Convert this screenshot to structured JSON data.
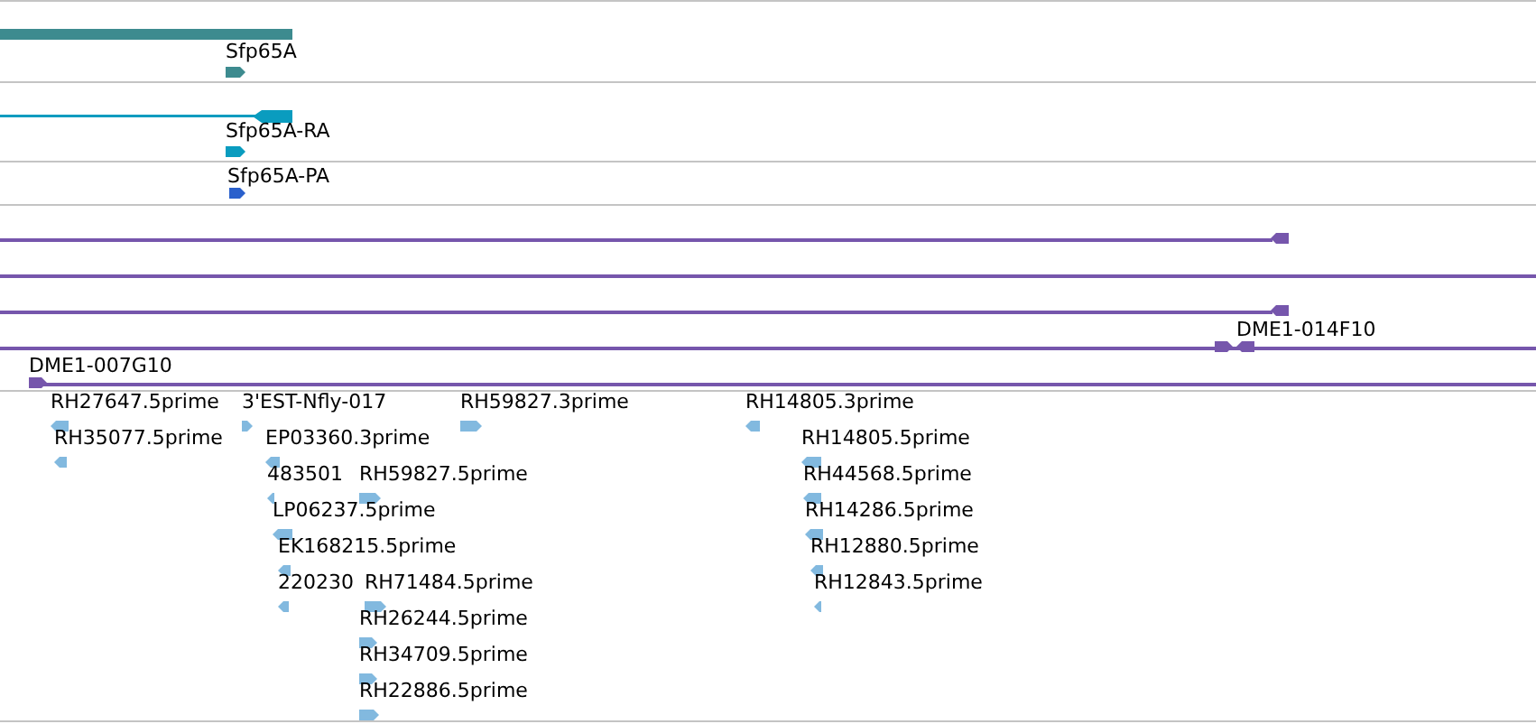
{
  "tracks": [
    {
      "kind": "gene",
      "color": "#3d8b8f",
      "features": [
        {
          "label": "Sfp65A",
          "reverse": false
        }
      ]
    },
    {
      "kind": "transcript",
      "color": "#0a9cbf",
      "features": [
        {
          "label": "Sfp65A-RA",
          "reverse": false
        }
      ]
    },
    {
      "kind": "protein",
      "color": "#2a60cc",
      "features": [
        {
          "label": "Sfp65A-PA",
          "reverse": false
        }
      ]
    },
    {
      "kind": "clone",
      "color": "#7656ac",
      "features": [
        {
          "kind": "arrow",
          "reverse": true
        },
        {
          "kind": "plain"
        },
        {
          "kind": "arrow",
          "reverse": true
        },
        {
          "kind": "pair",
          "label": "DME1-014F10"
        },
        {
          "kind": "arrow",
          "label": "DME1-007G10",
          "reverse": false
        }
      ]
    },
    {
      "kind": "est",
      "color": "#82b9df",
      "features": [
        {
          "label": "RH27647.5prime",
          "reverse": true
        },
        {
          "label": "3'EST-Nfly-017",
          "reverse": false
        },
        {
          "label": "RH59827.3prime",
          "reverse": false
        },
        {
          "label": "RH14805.3prime",
          "reverse": true
        },
        {
          "label": "RH35077.5prime",
          "reverse": true
        },
        {
          "label": "EP03360.3prime",
          "reverse": true
        },
        {
          "label": "RH14805.5prime",
          "reverse": true
        },
        {
          "label": "483501",
          "reverse": true
        },
        {
          "label": "RH59827.5prime",
          "reverse": false
        },
        {
          "label": "RH44568.5prime",
          "reverse": true
        },
        {
          "label": "LP06237.5prime",
          "reverse": true
        },
        {
          "label": "RH14286.5prime",
          "reverse": true
        },
        {
          "label": "EK168215.5prime",
          "reverse": true
        },
        {
          "label": "RH12880.5prime",
          "reverse": true
        },
        {
          "label": "220230",
          "reverse": true
        },
        {
          "label": "RH71484.5prime",
          "reverse": false
        },
        {
          "label": "RH12843.5prime",
          "reverse": true
        },
        {
          "label": "RH26244.5prime",
          "reverse": false
        },
        {
          "label": "RH34709.5prime",
          "reverse": false
        },
        {
          "label": "RH22886.5prime",
          "reverse": false
        }
      ]
    }
  ]
}
